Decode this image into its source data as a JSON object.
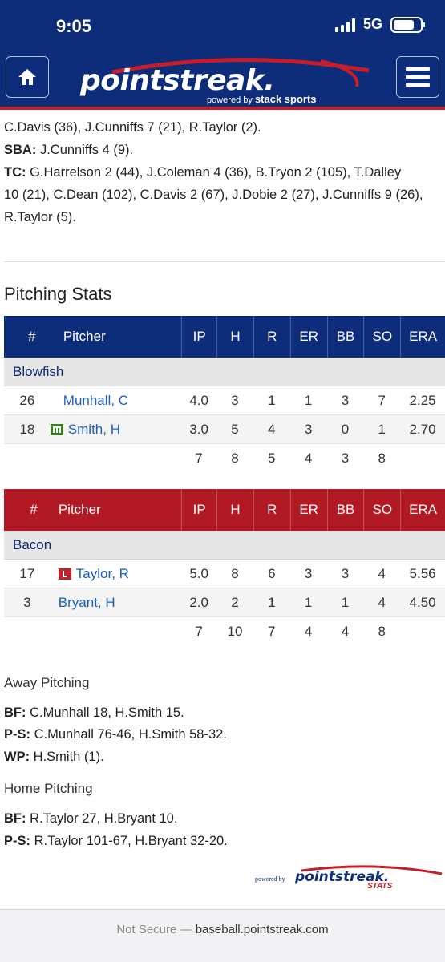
{
  "status_bar": {
    "time": "9:05",
    "network": "5G"
  },
  "header": {
    "logo_text": "pointstreak.",
    "powered_by": "powered by",
    "brand": "stack sports"
  },
  "batting_notes": {
    "line1": "C.Davis (36), J.Cunniffs 7 (21), R.Taylor (2).",
    "sba_label": "SBA:",
    "sba_value": "J.Cunniffs 4 (9).",
    "tc_label": "TC:",
    "tc_line1": "G.Harrelson 2 (44), J.Coleman 4 (36), B.Tryon 2 (105), T.Dalley",
    "tc_line2": "10 (21), C.Dean (102), C.Davis 2 (67), J.Dobie 2 (27), J.Cunniffs 9 (26),",
    "tc_line3": "R.Taylor (5)."
  },
  "pitching_title": "Pitching Stats",
  "columns": {
    "num": "#",
    "pitcher": "Pitcher",
    "ip": "IP",
    "h": "H",
    "r": "R",
    "er": "ER",
    "bb": "BB",
    "so": "SO",
    "era": "ERA"
  },
  "away": {
    "team": "Blowfish",
    "rows": [
      {
        "num": "26",
        "name": "Munhall, C",
        "ip": "4.0",
        "h": "3",
        "r": "1",
        "er": "1",
        "bb": "3",
        "so": "7",
        "era": "2.25"
      },
      {
        "num": "18",
        "name": "Smith, H",
        "ip": "3.0",
        "h": "5",
        "r": "4",
        "er": "3",
        "bb": "0",
        "so": "1",
        "era": "2.70"
      }
    ],
    "totals": {
      "ip": "7",
      "h": "8",
      "r": "5",
      "er": "4",
      "bb": "3",
      "so": "8"
    }
  },
  "home": {
    "team": "Bacon",
    "rows": [
      {
        "num": "17",
        "name": "Taylor, R",
        "ip": "5.0",
        "h": "8",
        "r": "6",
        "er": "3",
        "bb": "3",
        "so": "4",
        "era": "5.56"
      },
      {
        "num": "3",
        "name": "Bryant, H",
        "ip": "2.0",
        "h": "2",
        "r": "1",
        "er": "1",
        "bb": "1",
        "so": "4",
        "era": "4.50"
      }
    ],
    "totals": {
      "ip": "7",
      "h": "10",
      "r": "7",
      "er": "4",
      "bb": "4",
      "so": "8"
    }
  },
  "away_pitching": {
    "title": "Away Pitching",
    "bf_label": "BF:",
    "bf_value": "C.Munhall 18, H.Smith 15.",
    "ps_label": "P-S:",
    "ps_value": "C.Munhall 76-46, H.Smith 58-32.",
    "wp_label": "WP:",
    "wp_value": "H.Smith (1)."
  },
  "home_pitching": {
    "title": "Home Pitching",
    "bf_label": "BF:",
    "bf_value": "R.Taylor 27, H.Bryant 10.",
    "ps_label": "P-S:",
    "ps_value": "R.Taylor 101-67, H.Bryant 32-20."
  },
  "footer": {
    "powered_by": "powered by",
    "logo_text": "pointstreak.",
    "logo_sub": "STATS"
  },
  "url_bar": {
    "not_secure": "Not Secure",
    "sep": " — ",
    "domain": "baseball.pointstreak.com"
  },
  "colors": {
    "header_blue": "#0d2c7a",
    "accent_red": "#c41e2a",
    "link_blue": "#1a5fc2"
  }
}
